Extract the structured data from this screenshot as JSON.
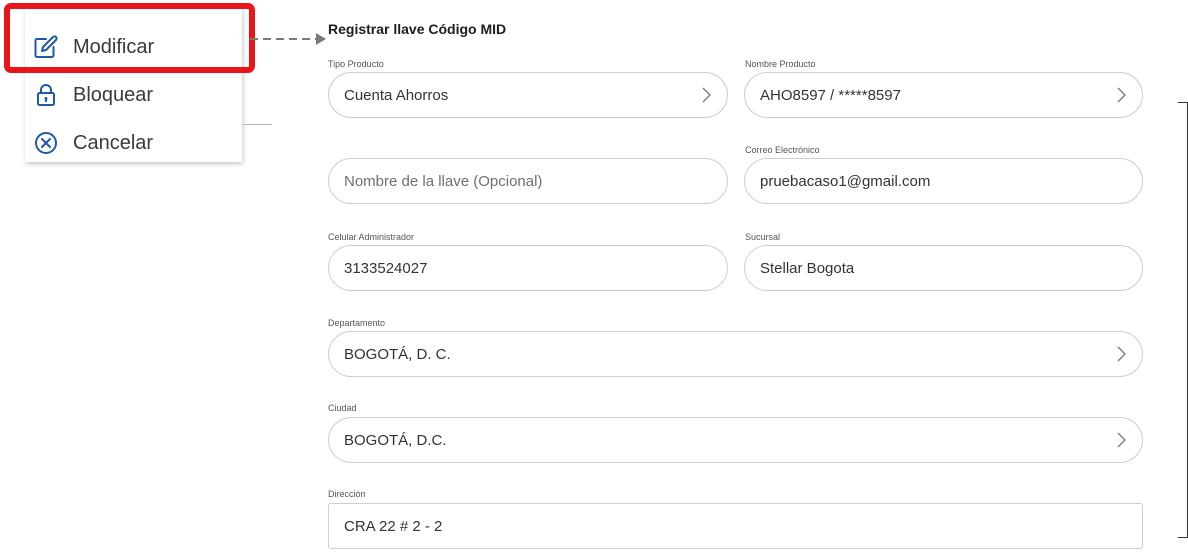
{
  "menu": {
    "items": [
      {
        "label": "Modificar",
        "icon": "edit-icon"
      },
      {
        "label": "Bloquear",
        "icon": "lock-icon"
      },
      {
        "label": "Cancelar",
        "icon": "cancel-circle-icon"
      }
    ],
    "highlight_color": "#e8151b"
  },
  "form": {
    "title": "Registrar llave Código MID",
    "fields": {
      "tipo_producto": {
        "label": "Tipo Producto",
        "value": "Cuenta Ahorros"
      },
      "nombre_producto": {
        "label": "Nombre Producto",
        "value": "AHO8597 / *****8597"
      },
      "nombre_llave": {
        "label": "",
        "placeholder": "Nombre de la llave (Opcional)",
        "value": ""
      },
      "correo": {
        "label": "Correo Electrónico",
        "value": "pruebacaso1@gmail.com"
      },
      "celular": {
        "label": "Celular Administrador",
        "value": "3133524027"
      },
      "sucursal": {
        "label": "Sucursal",
        "value": "Stellar Bogota"
      },
      "departamento": {
        "label": "Departamento",
        "value": "BOGOTÁ, D. C."
      },
      "ciudad": {
        "label": "Ciudad",
        "value": "BOGOTÁ, D.C."
      },
      "direccion": {
        "label": "Dirección",
        "value": "CRA 22 # 2 - 2"
      }
    }
  }
}
